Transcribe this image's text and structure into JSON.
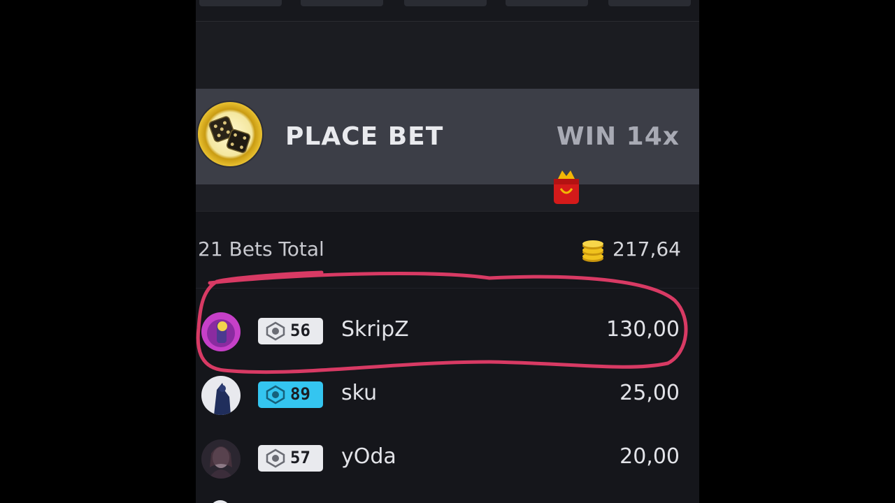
{
  "place_bet": {
    "label": "PLACE BET",
    "win_label": "WIN 14x",
    "icon": "dice-icon"
  },
  "summary": {
    "bets_total": "21 Bets Total",
    "total_amount": "217,64",
    "icon": "coins-icon"
  },
  "bets": [
    {
      "level": "56",
      "username": "SkripZ",
      "amount": "130,00",
      "badge_color": "#e9eaee",
      "highlighted": true
    },
    {
      "level": "89",
      "username": "sku",
      "amount": "25,00",
      "badge_color": "#34c5f0",
      "highlighted": false
    },
    {
      "level": "57",
      "username": "yOda",
      "amount": "20,00",
      "badge_color": "#e9eaee",
      "highlighted": false
    }
  ],
  "colors": {
    "highlight_stroke": "#d83a64",
    "panel_bg": "#15161b",
    "place_bet_bg": "#3c3e47"
  }
}
